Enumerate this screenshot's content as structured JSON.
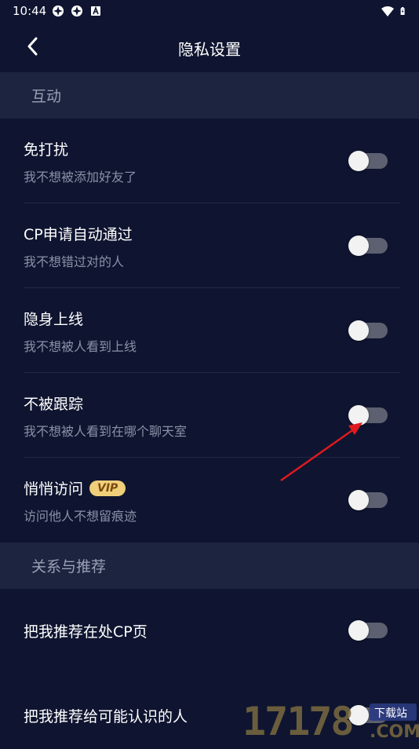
{
  "status_bar": {
    "time": "10:44",
    "left_icons": [
      "app-icon",
      "app-icon",
      "notification-a-icon"
    ],
    "right_icons": [
      "wifi-icon",
      "battery-icon"
    ]
  },
  "header": {
    "back_icon": "back-chevron-icon",
    "title": "隐私设置"
  },
  "sections": [
    {
      "title": "互动",
      "items": [
        {
          "title": "免打扰",
          "subtitle": "我不想被添加好友了",
          "toggle_on": false
        },
        {
          "title": "CP申请自动通过",
          "subtitle": "我不想错过对的人",
          "toggle_on": false
        },
        {
          "title": "隐身上线",
          "subtitle": "我不想被人看到上线",
          "toggle_on": false
        },
        {
          "title": "不被跟踪",
          "subtitle": "我不想被人看到在哪个聊天室",
          "toggle_on": false
        },
        {
          "title": "悄悄访问",
          "badge": "VIP",
          "subtitle": "访问他人不想留痕迹",
          "toggle_on": false
        }
      ]
    },
    {
      "title": "关系与推荐",
      "items": [
        {
          "title": "把我推荐在处CP页",
          "toggle_on": false
        },
        {
          "title": "把我推荐给可能认识的人",
          "toggle_on": false
        }
      ]
    }
  ],
  "annotation": {
    "type": "red-arrow",
    "points_to": "不被跟踪 toggle"
  },
  "watermark": {
    "text": "17178",
    "suffix": ".COM",
    "badge": "下载站"
  },
  "colors": {
    "background": "#0f1530",
    "section_header_bg": "#1c2440",
    "toggle_track_off": "#5c6070",
    "toggle_knob": "#f2f2f2",
    "vip_badge": "#f0cf7a",
    "arrow": "#e0191e"
  }
}
